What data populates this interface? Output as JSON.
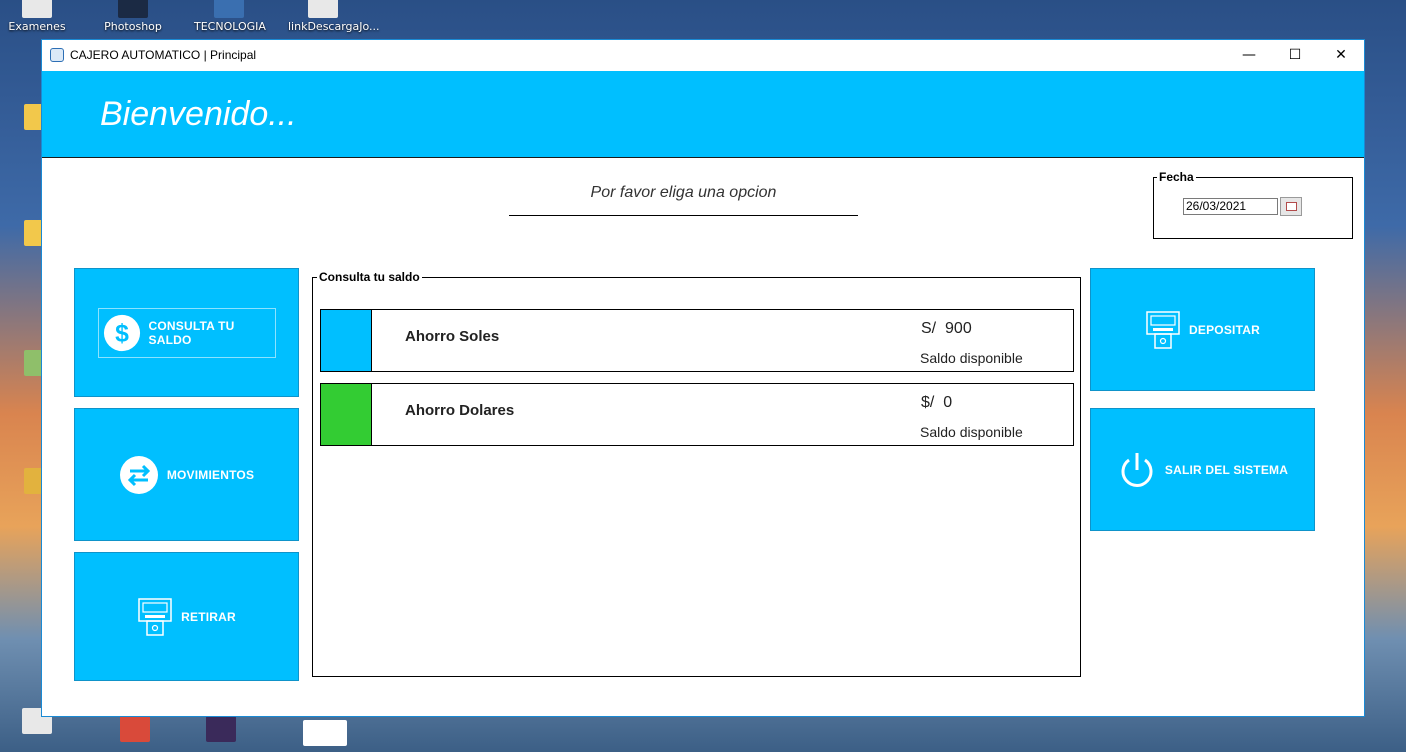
{
  "desktop": {
    "icons": [
      "Examenes",
      "Photoshop",
      "TECNOLOGIA",
      "linkDescargaJo..."
    ]
  },
  "window": {
    "title": "CAJERO AUTOMATICO  | Principal",
    "controls": {
      "minimize": "—",
      "maximize": "☐",
      "close": "✕"
    }
  },
  "banner": {
    "welcome": "Bienvenido..."
  },
  "prompt": "Por favor eliga una opcion",
  "fecha": {
    "legend": "Fecha",
    "value": "26/03/2021"
  },
  "menu": {
    "consulta": "CONSULTA TU SALDO",
    "movimientos": "MOVIMIENTOS",
    "retirar": "RETIRAR",
    "depositar": "DEPOSITAR",
    "salir": "SALIR DEL SISTEMA"
  },
  "consulta": {
    "legend": "Consulta tu saldo",
    "accounts": [
      {
        "name": "Ahorro Soles",
        "currency": "S/",
        "amount": "900",
        "caption": "Saldo disponible",
        "color": "#00bfff"
      },
      {
        "name": "Ahorro Dolares",
        "currency": "$/",
        "amount": "0",
        "caption": "Saldo disponible",
        "color": "#33cc33"
      }
    ]
  }
}
